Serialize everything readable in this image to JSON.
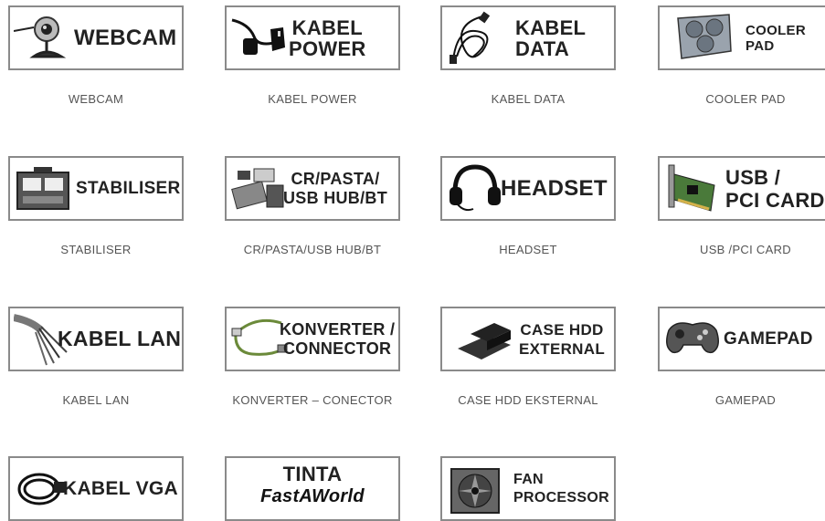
{
  "categories": [
    {
      "card_lines": [
        "WEBCAM"
      ],
      "caption": "WEBCAM",
      "icon": "webcam-icon"
    },
    {
      "card_lines": [
        "KABEL",
        "POWER"
      ],
      "caption": "KABEL POWER",
      "icon": "power-cable-icon"
    },
    {
      "card_lines": [
        "KABEL",
        "DATA"
      ],
      "caption": "KABEL DATA",
      "icon": "data-cable-icon"
    },
    {
      "card_lines": [
        "COOLER",
        "PAD"
      ],
      "caption": "COOLER PAD",
      "icon": "cooler-pad-icon"
    },
    {
      "card_lines": [
        "STABILISER"
      ],
      "caption": "STABILISER",
      "icon": "stabiliser-icon"
    },
    {
      "card_lines": [
        "CR/PASTA/",
        "USB HUB/BT"
      ],
      "caption": "CR/PASTA/USB HUB/BT",
      "icon": "card-reader-icon"
    },
    {
      "card_lines": [
        "HEADSET"
      ],
      "caption": "HEADSET",
      "icon": "headset-icon"
    },
    {
      "card_lines": [
        "USB /",
        "PCI CARD"
      ],
      "caption": "USB /PCI CARD",
      "icon": "pci-card-icon"
    },
    {
      "card_lines": [
        "KABEL LAN"
      ],
      "caption": "KABEL LAN",
      "icon": "lan-cable-icon"
    },
    {
      "card_lines": [
        "KONVERTER /",
        "CONNECTOR"
      ],
      "caption": "KONVERTER – CONECTOR",
      "icon": "converter-cable-icon"
    },
    {
      "card_lines": [
        "CASE HDD",
        "EXTERNAL"
      ],
      "caption": "CASE HDD EKSTERNAL",
      "icon": "hdd-case-icon"
    },
    {
      "card_lines": [
        "GAMEPAD"
      ],
      "caption": "GAMEPAD",
      "icon": "gamepad-icon"
    },
    {
      "card_lines": [
        "KABEL VGA"
      ],
      "caption": "",
      "icon": "vga-cable-icon"
    },
    {
      "card_lines": [
        "TINTA",
        "FastAWorld"
      ],
      "caption": "",
      "icon": "ink-logo-icon"
    },
    {
      "card_lines": [
        "FAN",
        "PROCESSOR"
      ],
      "caption": "",
      "icon": "cpu-fan-icon"
    }
  ],
  "colors": {
    "card_border": "#8a8a8a",
    "caption_text": "#555555",
    "card_text": "#222222"
  }
}
